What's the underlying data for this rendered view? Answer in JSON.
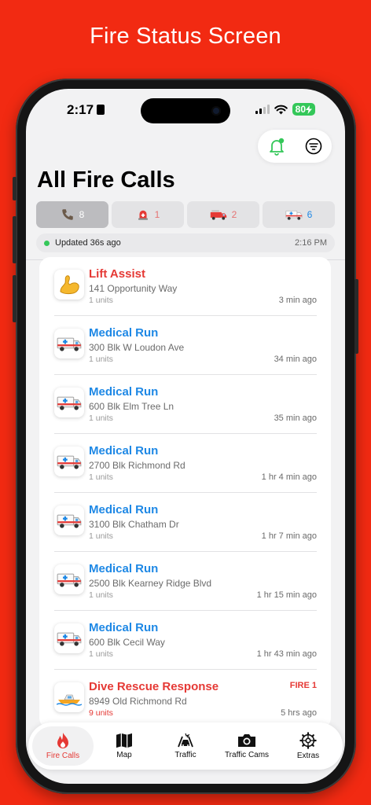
{
  "promo": {
    "title": "Fire Status Screen"
  },
  "status_bar": {
    "time": "2:17",
    "battery": "80"
  },
  "header": {
    "title": "All Fire Calls"
  },
  "filters": [
    {
      "icon": "phone-icon",
      "count": "8"
    },
    {
      "icon": "emergency-light-icon",
      "count": "1"
    },
    {
      "icon": "fire-engine-icon",
      "count": "2"
    },
    {
      "icon": "ambulance-icon",
      "count": "6"
    }
  ],
  "update": {
    "text": "Updated 36s ago",
    "time": "2:16 PM"
  },
  "calls": [
    {
      "title": "Lift Assist",
      "address": "141 Opportunity Way",
      "units": "1 units",
      "ago": "3 min ago",
      "icon": "flexed-bicep-icon",
      "color": "#e53935",
      "tag": ""
    },
    {
      "title": "Medical Run",
      "address": "300 Blk W Loudon Ave",
      "units": "1 units",
      "ago": "34 min ago",
      "icon": "ambulance-icon",
      "color": "#1e88e5",
      "tag": ""
    },
    {
      "title": "Medical Run",
      "address": "600 Blk Elm Tree Ln",
      "units": "1 units",
      "ago": "35 min ago",
      "icon": "ambulance-icon",
      "color": "#1e88e5",
      "tag": ""
    },
    {
      "title": "Medical Run",
      "address": "2700 Blk Richmond Rd",
      "units": "1 units",
      "ago": "1 hr 4 min ago",
      "icon": "ambulance-icon",
      "color": "#1e88e5",
      "tag": ""
    },
    {
      "title": "Medical Run",
      "address": "3100 Blk Chatham Dr",
      "units": "1 units",
      "ago": "1 hr 7 min ago",
      "icon": "ambulance-icon",
      "color": "#1e88e5",
      "tag": ""
    },
    {
      "title": "Medical Run",
      "address": "2500 Blk Kearney Ridge Blvd",
      "units": "1 units",
      "ago": "1 hr 15 min ago",
      "icon": "ambulance-icon",
      "color": "#1e88e5",
      "tag": ""
    },
    {
      "title": "Medical Run",
      "address": "600 Blk Cecil Way",
      "units": "1 units",
      "ago": "1 hr 43 min ago",
      "icon": "ambulance-icon",
      "color": "#1e88e5",
      "tag": ""
    },
    {
      "title": "Dive Rescue Response",
      "address": "8949 Old Richmond Rd",
      "units": "9 units",
      "ago": "5 hrs ago",
      "icon": "speedboat-icon",
      "color": "#e53935",
      "tag": "FIRE 1"
    }
  ],
  "tabs": [
    {
      "label": "Fire Calls",
      "icon": "flame-icon",
      "active": true
    },
    {
      "label": "Map",
      "icon": "map-icon",
      "active": false
    },
    {
      "label": "Traffic",
      "icon": "car-crash-icon",
      "active": false
    },
    {
      "label": "Traffic Cams",
      "icon": "camera-icon",
      "active": false
    },
    {
      "label": "Extras",
      "icon": "gear-icon",
      "active": false
    }
  ],
  "colors": {
    "background": "#f22a12",
    "accent_red": "#e53935",
    "accent_blue": "#1e88e5",
    "live_green": "#34c759"
  }
}
